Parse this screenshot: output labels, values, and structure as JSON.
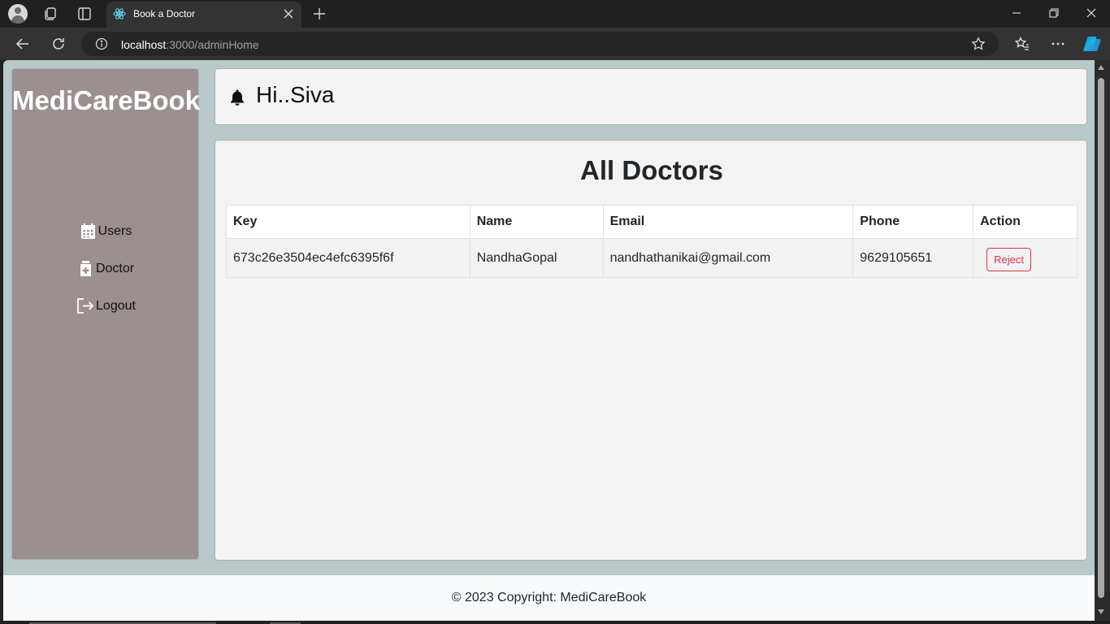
{
  "browser": {
    "tab_title": "Book a Doctor",
    "url_host": "localhost",
    "url_path": ":3000/adminHome"
  },
  "sidebar": {
    "brand": "MediCareBook",
    "items": [
      {
        "label": "Users",
        "icon": "calendar-icon"
      },
      {
        "label": "Doctor",
        "icon": "medical-kit-icon"
      },
      {
        "label": "Logout",
        "icon": "logout-icon"
      }
    ]
  },
  "header": {
    "greeting": "Hi..Siva",
    "icon": "bell-icon"
  },
  "content": {
    "title": "All Doctors",
    "columns": [
      "Key",
      "Name",
      "Email",
      "Phone",
      "Action"
    ],
    "rows": [
      {
        "key": "673c26e3504ec4efc6395f6f",
        "name": "NandhaGopal",
        "email": "nandhathanikai@gmail.com",
        "phone": "9629105651",
        "action": "Reject"
      }
    ]
  },
  "footer": {
    "text": "© 2023 Copyright: MediCareBook"
  },
  "colors": {
    "sidebar_bg": "#9b8f8f",
    "page_bg": "#b9c9c9",
    "reject": "#dc3545"
  }
}
